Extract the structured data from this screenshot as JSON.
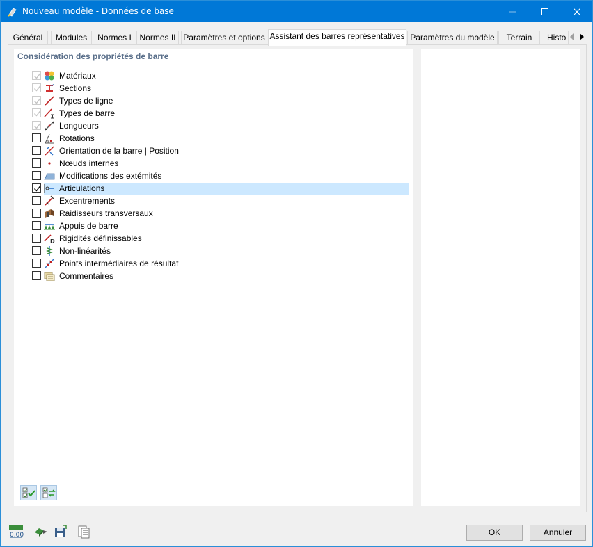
{
  "window": {
    "title": "Nouveau modèle - Données de base"
  },
  "tabs": [
    {
      "label": "Général"
    },
    {
      "label": "Modules"
    },
    {
      "label": "Normes I"
    },
    {
      "label": "Normes II"
    },
    {
      "label": "Paramètres et options"
    },
    {
      "label": "Assistant des barres représentatives",
      "active": true
    },
    {
      "label": "Paramètres du modèle"
    },
    {
      "label": "Terrain"
    },
    {
      "label": "Histo"
    }
  ],
  "panel": {
    "title": "Considération des propriétés de barre",
    "items": [
      {
        "label": "Matériaux",
        "checked": true,
        "disabled": true,
        "icon": "materials-icon"
      },
      {
        "label": "Sections",
        "checked": true,
        "disabled": true,
        "icon": "sections-icon"
      },
      {
        "label": "Types de ligne",
        "checked": true,
        "disabled": true,
        "icon": "line-type-icon"
      },
      {
        "label": "Types de barre",
        "checked": true,
        "disabled": true,
        "icon": "member-type-icon"
      },
      {
        "label": "Longueurs",
        "checked": true,
        "disabled": true,
        "icon": "length-icon"
      },
      {
        "label": "Rotations",
        "checked": false,
        "disabled": false,
        "icon": "rotation-icon"
      },
      {
        "label": "Orientation de la barre | Position",
        "checked": false,
        "disabled": false,
        "icon": "orientation-icon"
      },
      {
        "label": "Nœuds internes",
        "checked": false,
        "disabled": false,
        "icon": "internal-node-icon"
      },
      {
        "label": "Modifications des extémités",
        "checked": false,
        "disabled": false,
        "icon": "end-modification-icon"
      },
      {
        "label": "Articulations",
        "checked": true,
        "disabled": false,
        "selected": true,
        "icon": "hinge-icon"
      },
      {
        "label": "Excentrements",
        "checked": false,
        "disabled": false,
        "icon": "eccentricity-icon"
      },
      {
        "label": "Raidisseurs transversaux",
        "checked": false,
        "disabled": false,
        "icon": "stiffener-icon"
      },
      {
        "label": "Appuis de barre",
        "checked": false,
        "disabled": false,
        "icon": "member-support-icon"
      },
      {
        "label": "Rigidités définissables",
        "checked": false,
        "disabled": false,
        "icon": "stiffness-icon"
      },
      {
        "label": "Non-linéarités",
        "checked": false,
        "disabled": false,
        "icon": "nonlinearity-icon"
      },
      {
        "label": "Points intermédiaires de résultat",
        "checked": false,
        "disabled": false,
        "icon": "result-points-icon"
      },
      {
        "label": "Commentaires",
        "checked": false,
        "disabled": false,
        "icon": "comments-icon"
      }
    ]
  },
  "footer": {
    "ok_label": "OK",
    "cancel_label": "Annuler",
    "units_label": "0,00"
  },
  "colors": {
    "titlebar": "#0078d7",
    "selection": "#cce8ff",
    "section_title": "#5a6f8a"
  }
}
